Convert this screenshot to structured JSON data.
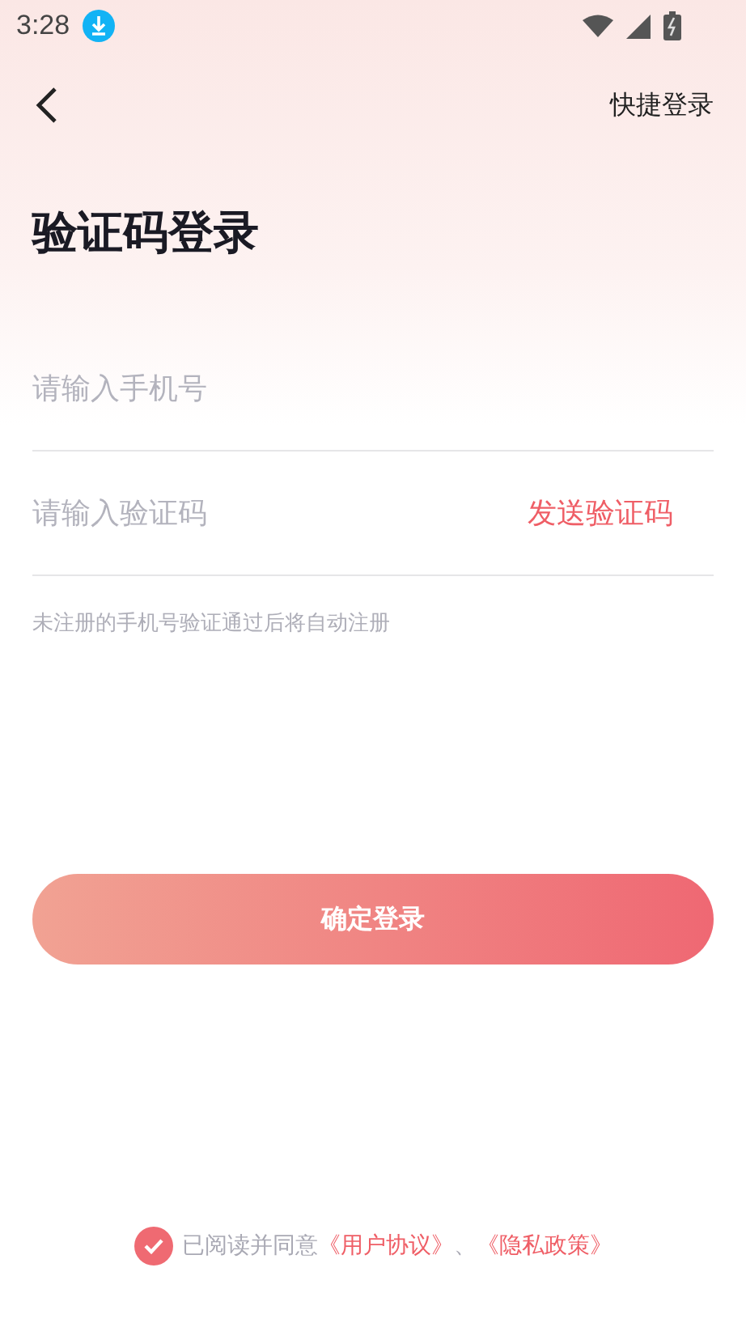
{
  "status_bar": {
    "time": "3:28"
  },
  "header": {
    "action": "快捷登录"
  },
  "title": "验证码登录",
  "fields": [
    {
      "placeholder": "请输入手机号"
    },
    {
      "placeholder": "请输入验证码",
      "action": "发送验证码"
    }
  ],
  "hint": "未注册的手机号验证通过后将自动注册",
  "submit": "确定登录",
  "agreement": {
    "checked": true,
    "text": "已阅读并同意",
    "links": [
      "《用户协议》",
      "《隐私政策》"
    ],
    "separator": "、"
  }
}
